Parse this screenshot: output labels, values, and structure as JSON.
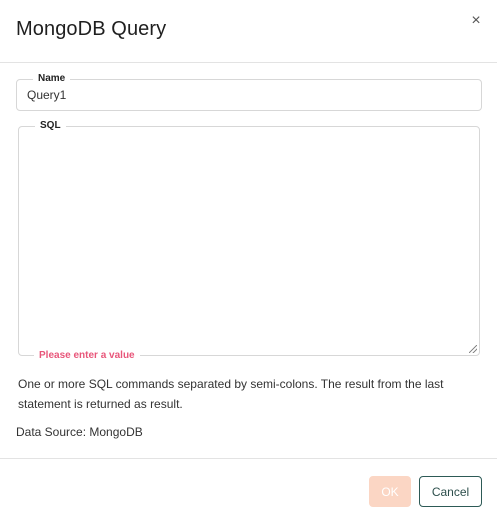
{
  "dialog": {
    "title": "MongoDB Query",
    "close_glyph": "×",
    "close_icon": "close-icon"
  },
  "name_field": {
    "label": "Name",
    "value": "Query1"
  },
  "sql_field": {
    "label": "SQL",
    "value": "",
    "error": "Please enter a value"
  },
  "help_text": "One or more SQL commands separated by semi-colons. The result from the last statement is returned as result.",
  "datasource": "Data Source: MongoDB",
  "footer": {
    "ok_label": "OK",
    "cancel_label": "Cancel"
  },
  "colors": {
    "ok_disabled_bg": "#fbd6c4",
    "cancel_border": "#2d5a56",
    "error_text": "#e8567a"
  }
}
